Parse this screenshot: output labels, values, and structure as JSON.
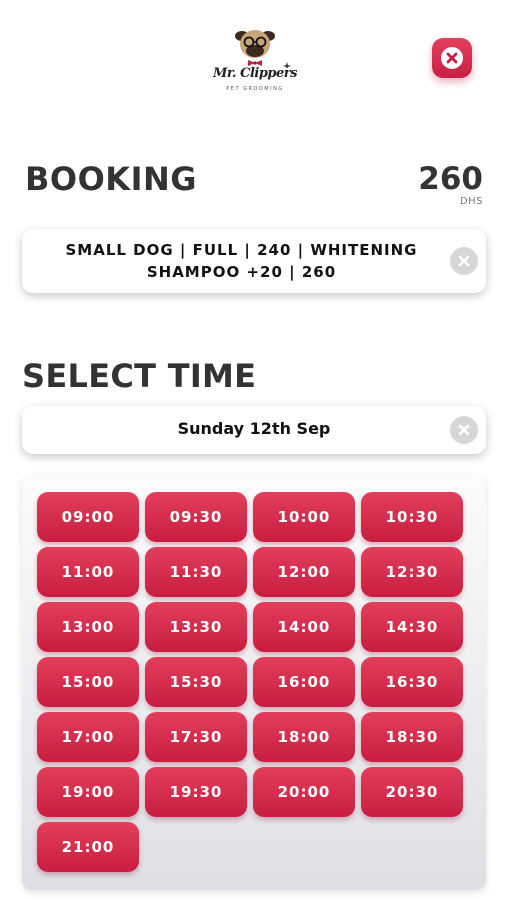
{
  "header": {
    "logo_text": "Mr. Clippers",
    "logo_subtext": "PET GROOMING",
    "close_icon": "close-icon"
  },
  "booking": {
    "title": "BOOKING",
    "price": "260",
    "currency": "DHS",
    "service_summary": "SMALL DOG | FULL | 240 | WHITENING SHAMPOO +20 | 260",
    "clear_icon": "clear-icon"
  },
  "select_time": {
    "title": "SELECT TIME",
    "selected_date": "Sunday 12th Sep",
    "clear_icon": "clear-icon"
  },
  "time_slots": [
    "09:00",
    "09:30",
    "10:00",
    "10:30",
    "11:00",
    "11:30",
    "12:00",
    "12:30",
    "13:00",
    "13:30",
    "14:00",
    "14:30",
    "15:00",
    "15:30",
    "16:00",
    "16:30",
    "17:00",
    "17:30",
    "18:00",
    "18:30",
    "19:00",
    "19:30",
    "20:00",
    "20:30",
    "21:00"
  ],
  "colors": {
    "accent": "#d6304f",
    "accent_dark": "#c81d40",
    "text_dark": "#333333",
    "panel_bg": "#ececf0",
    "clear_icon_bg": "#d7d7d7"
  }
}
